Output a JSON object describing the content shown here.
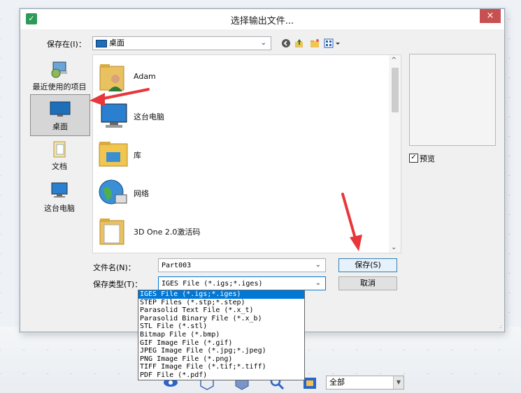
{
  "dialog": {
    "title": "选择输出文件...",
    "close_label": "×"
  },
  "save_in": {
    "label": "保存在(I)：",
    "value": "桌面"
  },
  "places": [
    {
      "label": "最近使用的项目",
      "icon": "recent-items-icon"
    },
    {
      "label": "桌面",
      "icon": "desktop-icon",
      "selected": true
    },
    {
      "label": "文档",
      "icon": "documents-icon"
    },
    {
      "label": "这台电脑",
      "icon": "this-pc-icon"
    }
  ],
  "files": [
    {
      "name": "Adam",
      "icon": "user-folder-icon"
    },
    {
      "name": "这台电脑",
      "icon": "computer-icon"
    },
    {
      "name": "库",
      "icon": "library-icon"
    },
    {
      "name": "网络",
      "icon": "network-icon"
    },
    {
      "name": "3D One 2.0激活码",
      "icon": "folder-icon"
    }
  ],
  "preview": {
    "checkbox_label": "预览",
    "checked": true,
    "check_mark": "✓"
  },
  "filename": {
    "label": "文件名(N)：",
    "value": "Part003"
  },
  "save_type": {
    "label": "保存类型(T)：",
    "value": "IGES File (*.igs;*.iges)",
    "options": [
      "IGES File (*.igs;*.iges)",
      "STEP Files (*.stp;*.step)",
      "Parasolid Text File (*.x_t)",
      "Parasolid Binary File (*.x_b)",
      "STL File (*.stl)",
      "Bitmap File (*.bmp)",
      "GIF Image File (*.gif)",
      "JPEG Image File (*.jpg;*.jpeg)",
      "PNG Image File (*.png)",
      "TIFF Image File (*.tif;*.tiff)",
      "PDF File (*.pdf)"
    ]
  },
  "buttons": {
    "save": "保存(S)",
    "cancel": "取消"
  },
  "bottom_toolbar": {
    "filter_value": "全部"
  },
  "colors": {
    "accent": "#0078d7",
    "close": "#c75050",
    "arrow_red": "#e8373b"
  }
}
